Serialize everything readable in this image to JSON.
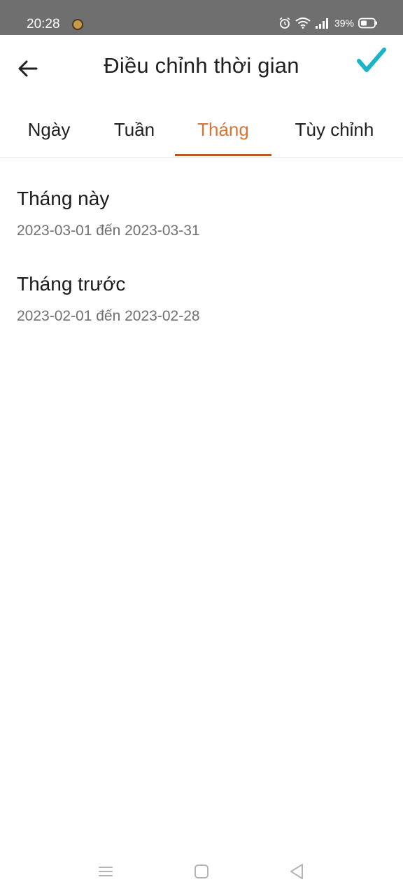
{
  "status_bar": {
    "time": "20:28",
    "battery_percent": "39%"
  },
  "app_bar": {
    "title": "Điều chỉnh thời gian"
  },
  "tabs": [
    {
      "label": "Ngày",
      "active": false
    },
    {
      "label": "Tuần",
      "active": false
    },
    {
      "label": "Tháng",
      "active": true
    },
    {
      "label": "Tùy chỉnh",
      "active": false
    }
  ],
  "ranges": [
    {
      "title": "Tháng này",
      "subtitle": "2023-03-01 đến 2023-03-31"
    },
    {
      "title": "Tháng trước",
      "subtitle": "2023-02-01 đến 2023-02-28"
    }
  ],
  "colors": {
    "accent": "#d97534",
    "indicator": "#b85a24",
    "confirm": "#1bb3c7",
    "status_bar": "#6f6f6f"
  },
  "icons": {
    "back": "arrow-left-icon",
    "confirm": "check-icon",
    "nav_menu": "menu-icon",
    "nav_home": "home-icon",
    "nav_back": "triangle-back-icon"
  }
}
